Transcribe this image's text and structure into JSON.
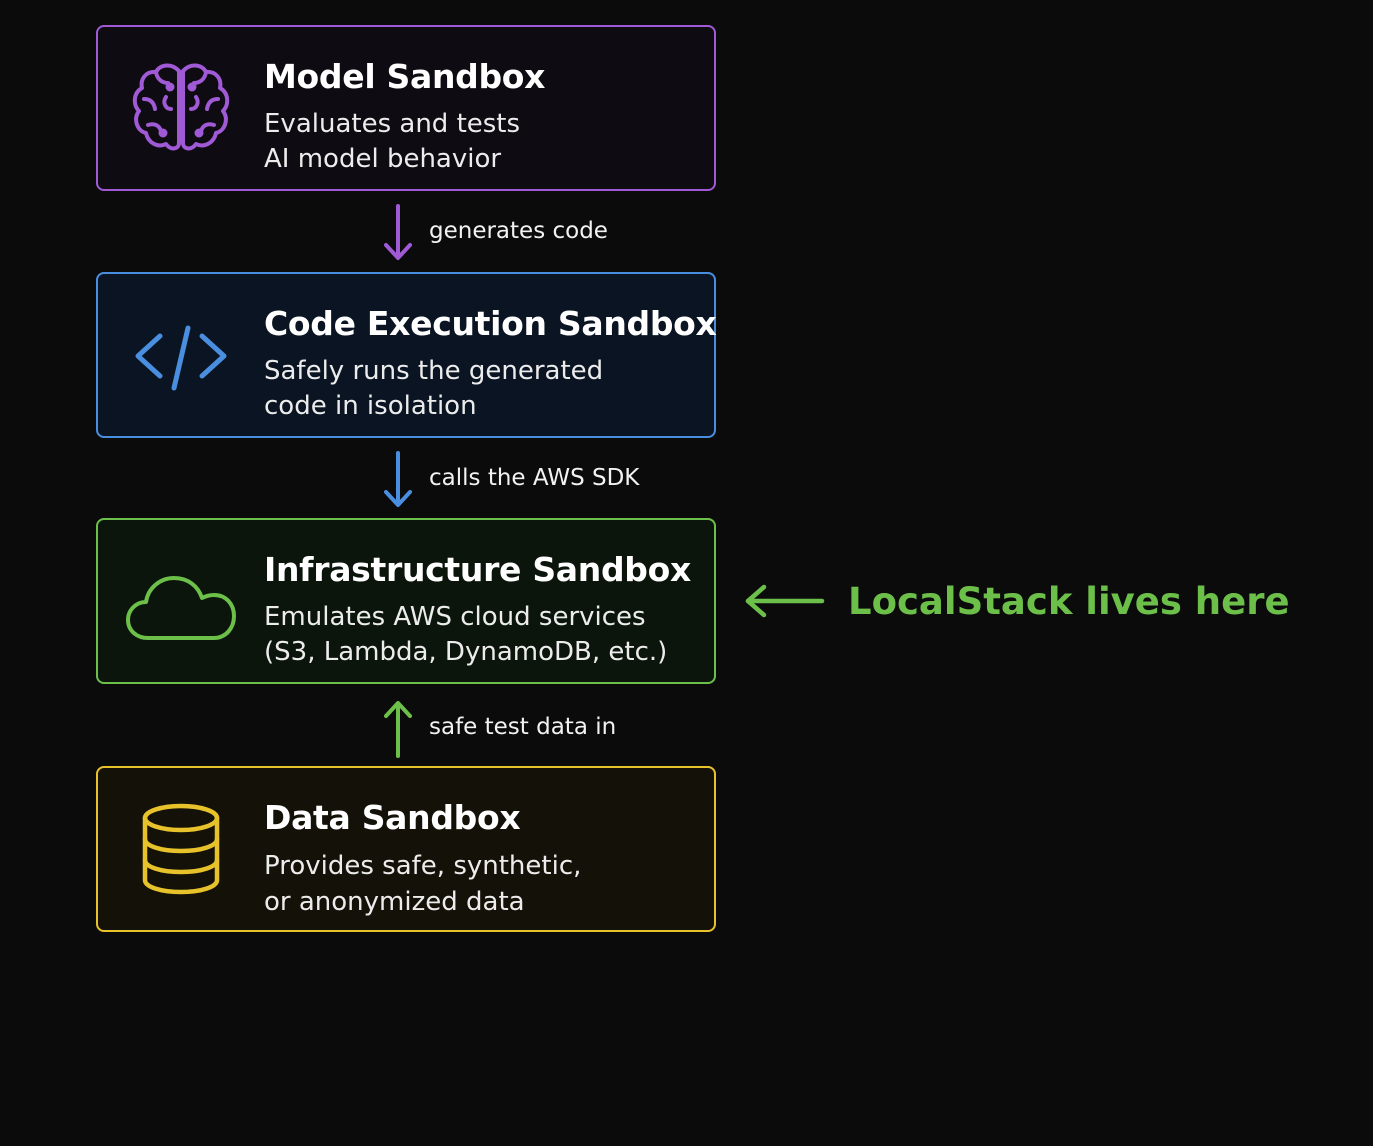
{
  "colors": {
    "background": "#0b0b0c",
    "model": "#a05ad6",
    "code": "#4a8ee0",
    "infra": "#6cc04a",
    "data": "#e8c22a"
  },
  "sandboxes": [
    {
      "title": "Model Sandbox",
      "description_line1": "Evaluates and tests",
      "description_line2": "AI model behavior",
      "icon": "brain-icon"
    },
    {
      "title": "Code Execution Sandbox",
      "description_line1": "Safely runs the generated",
      "description_line2": "code in isolation",
      "icon": "code-brackets-icon"
    },
    {
      "title": "Infrastructure Sandbox",
      "description_line1": "Emulates AWS cloud services",
      "description_line2": "(S3, Lambda, DynamoDB, etc.)",
      "icon": "cloud-icon"
    },
    {
      "title": "Data Sandbox",
      "description_line1": "Provides safe, synthetic,",
      "description_line2": "or anonymized data",
      "icon": "database-icon"
    }
  ],
  "connectors": [
    {
      "label": "generates code",
      "direction": "down"
    },
    {
      "label": "calls the AWS SDK",
      "direction": "down"
    },
    {
      "label": "safe test data in",
      "direction": "up"
    }
  ],
  "callout": {
    "text": "LocalStack lives here",
    "direction": "left"
  }
}
